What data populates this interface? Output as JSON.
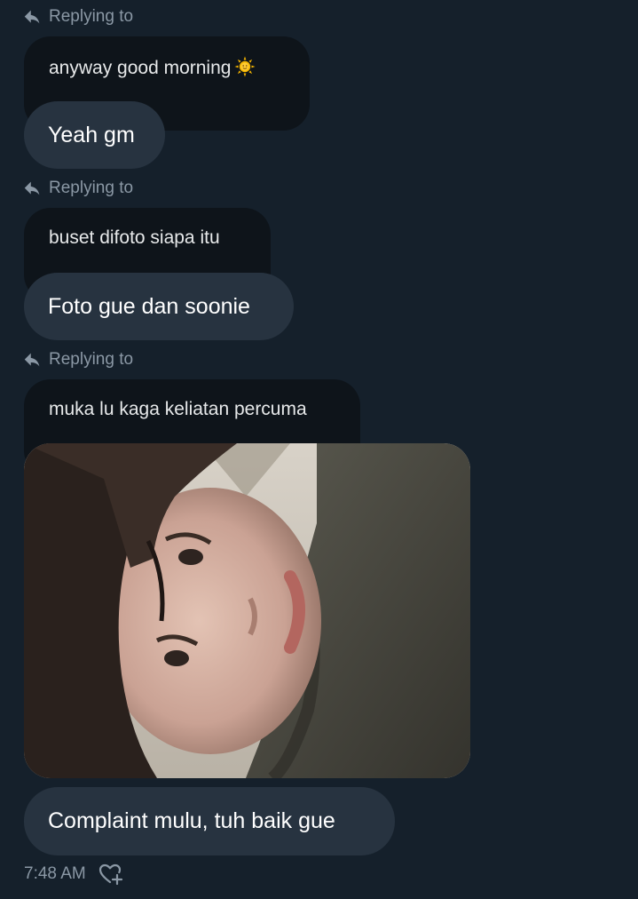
{
  "conversation": {
    "messages": [
      {
        "reply_label": "Replying to",
        "quoted_text": "anyway good morning",
        "quoted_emoji": "sun-with-face-icon",
        "reply_text": "Yeah gm"
      },
      {
        "reply_label": "Replying to",
        "quoted_text": "buset difoto siapa itu",
        "reply_text": "Foto gue dan soonie"
      },
      {
        "reply_label": "Replying to",
        "quoted_text": "muka lu kaga keliatan percuma",
        "attachment": "photo",
        "reply_text": "Complaint mulu, tuh baik gue"
      }
    ],
    "timestamp": "7:48 AM",
    "react_icon": "heart-plus-icon"
  },
  "colors": {
    "background": "#15202b",
    "quoted_bubble": "#0e141a",
    "reply_bubble": "#273340",
    "muted_text": "#8b98a5"
  }
}
